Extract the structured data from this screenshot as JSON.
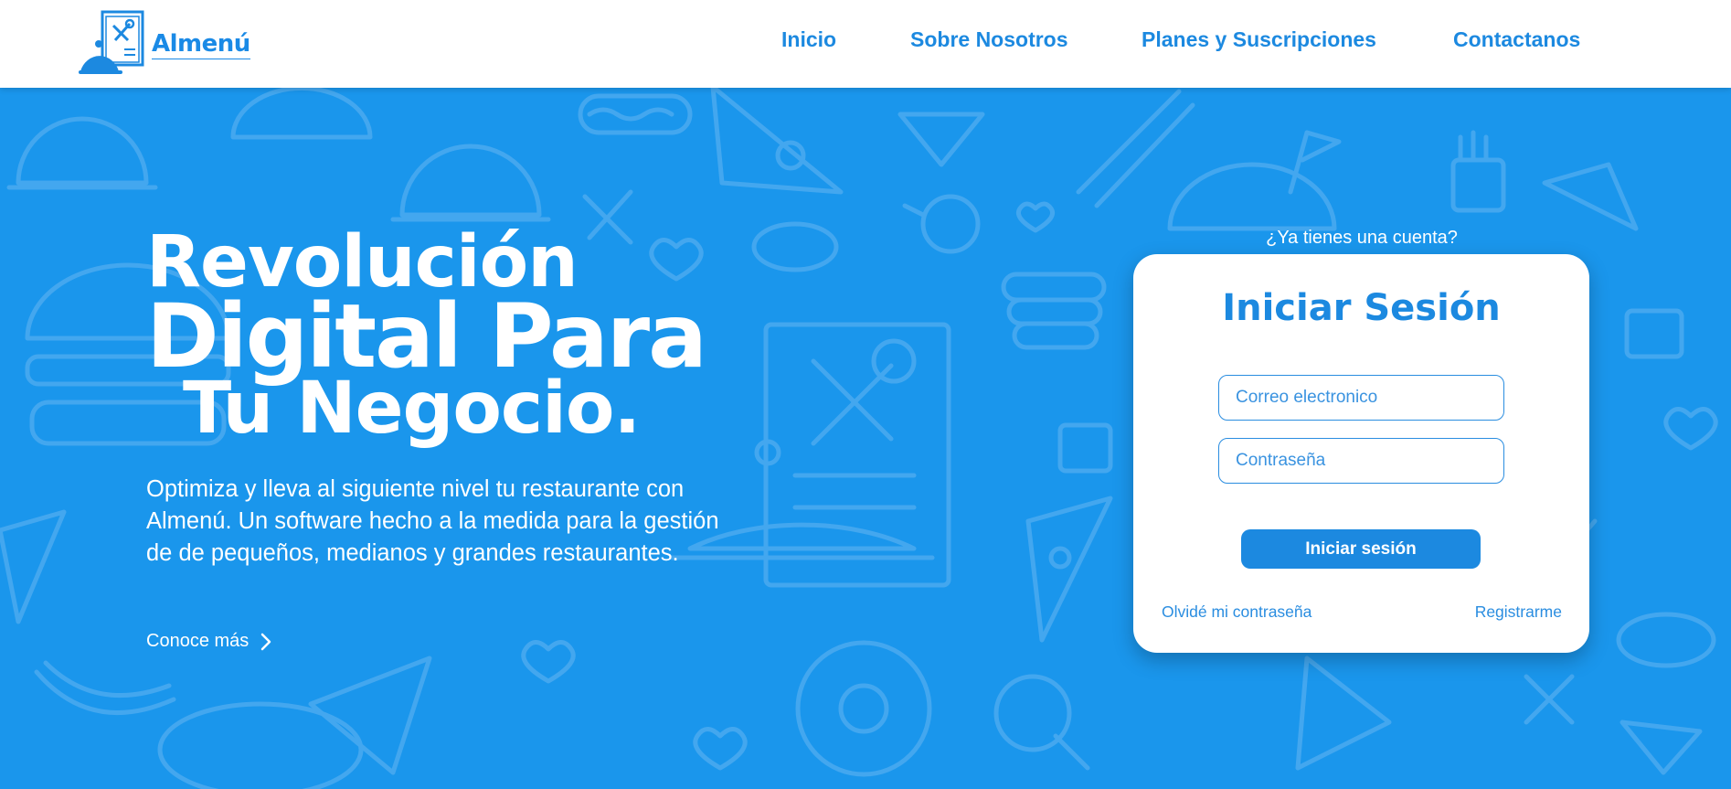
{
  "brand": {
    "name": "Almenú",
    "logo_icon": "cloche-menu-icon"
  },
  "nav": {
    "items": [
      {
        "label": "Inicio"
      },
      {
        "label": "Sobre Nosotros"
      },
      {
        "label": "Planes y Suscripciones"
      },
      {
        "label": "Contactanos"
      }
    ]
  },
  "hero": {
    "title_line1": "Revolución",
    "title_line2": "Digital Para",
    "title_line3": "Tu Negocio.",
    "description": "Optimiza y lleva al siguiente nivel tu restaurante con Almenú. Un software hecho a la medida para la gestión de de pequeños, medianos y grandes restaurantes.",
    "learn_more": "Conoce más"
  },
  "login": {
    "prompt": "¿Ya tienes una cuenta?",
    "title": "Iniciar Sesión",
    "email_placeholder": "Correo electronico",
    "email_value": "",
    "password_placeholder": "Contraseña",
    "password_value": "",
    "submit_label": "Iniciar sesión",
    "forgot_label": "Olvidé mi contraseña",
    "register_label": "Registrarme"
  },
  "colors": {
    "primary": "#1c89e0",
    "background": "#1a96ec",
    "doodle": "#4aabf0",
    "white": "#ffffff"
  }
}
